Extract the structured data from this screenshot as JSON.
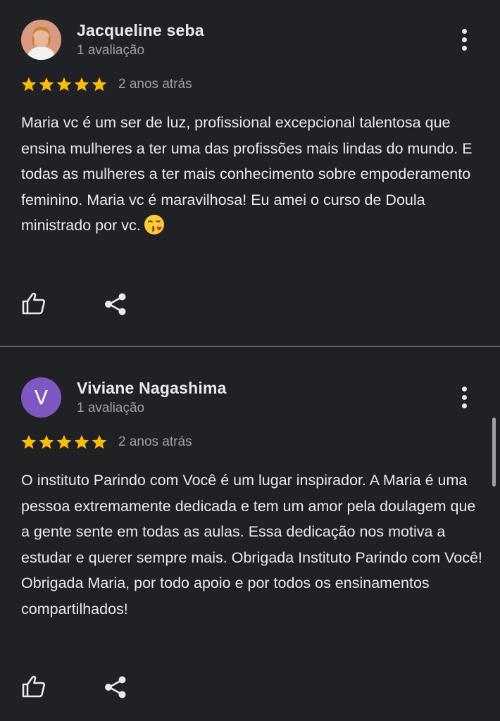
{
  "reviews": [
    {
      "author": "Jacqueline seba",
      "meta": "1 avaliação",
      "avatar": {
        "type": "photo"
      },
      "rating": 5,
      "date": "2 anos atrás",
      "text": "Maria vc é um ser de luz, profissional excepcional talentosa que ensina mulheres a ter uma das profissões mais lindas do mundo. E todas as mulheres a ter mais conhecimento sobre empoderamento feminino. Maria vc é maravilhosa! Eu amei o curso de Doula ministrado por vc.",
      "emoji": "face-blowing-a-kiss"
    },
    {
      "author": "Viviane Nagashima",
      "meta": "1 avaliação",
      "avatar": {
        "type": "letter",
        "letter": "V",
        "color": "#7e57c2"
      },
      "rating": 5,
      "date": "2 anos atrás",
      "text": "O instituto Parindo com Você é um lugar inspirador. A Maria é uma pessoa extremamente dedicada e tem um amor pela doulagem que a gente sente em todas as aulas. Essa dedicação nos motiva a estudar e querer sempre mais. Obrigada Instituto Parindo com Você! Obrigada Maria, por todo apoio e por todos os ensinamentos compartilhados!"
    }
  ],
  "icons": {
    "more": "more-vert-icon",
    "like": "thumbs-up-icon",
    "share": "share-icon",
    "star": "star-icon"
  },
  "colors": {
    "background": "#202124",
    "star": "#fbbc04",
    "primary_text": "#e8eaed",
    "secondary_text": "#9aa0a6",
    "divider": "#5f6368"
  }
}
